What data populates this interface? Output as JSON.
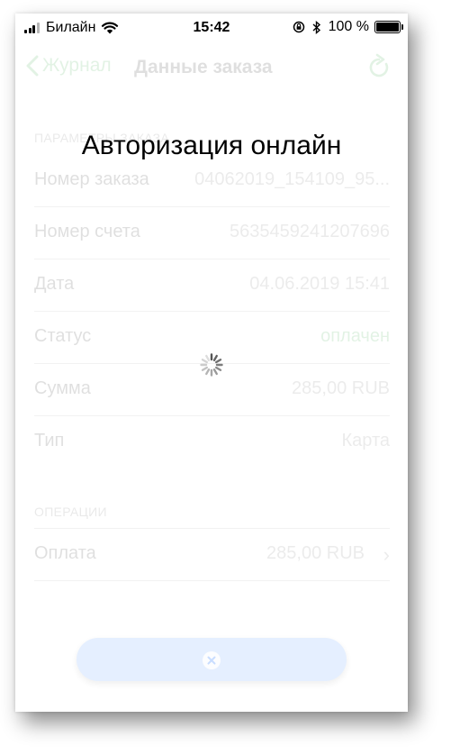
{
  "status_bar": {
    "carrier": "Билайн",
    "time": "15:42",
    "battery": "100 %"
  },
  "nav": {
    "back_label": "Журнал",
    "title": "Данные заказа"
  },
  "sections": {
    "order_params_header": "ПАРАМЕТРЫ ЗАКАЗА",
    "operations_header": "ОПЕРАЦИИ"
  },
  "order_rows": [
    {
      "label": "Номер заказа",
      "value": "04062019_154109_95..."
    },
    {
      "label": "Номер счета",
      "value": "5635459241207696"
    },
    {
      "label": "Дата",
      "value": "04.06.2019 15:41"
    },
    {
      "label": "Статус",
      "value": "оплачен"
    },
    {
      "label": "Сумма",
      "value": "285,00 RUB"
    },
    {
      "label": "Тип",
      "value": "Карта"
    }
  ],
  "operations": [
    {
      "label": "Оплата",
      "value": "285,00 RUB"
    }
  ],
  "overlay": {
    "title": "Авторизация онлайн"
  },
  "colors": {
    "accent_green": "#1a9e2e",
    "cancel_button": "#c6dcff"
  }
}
